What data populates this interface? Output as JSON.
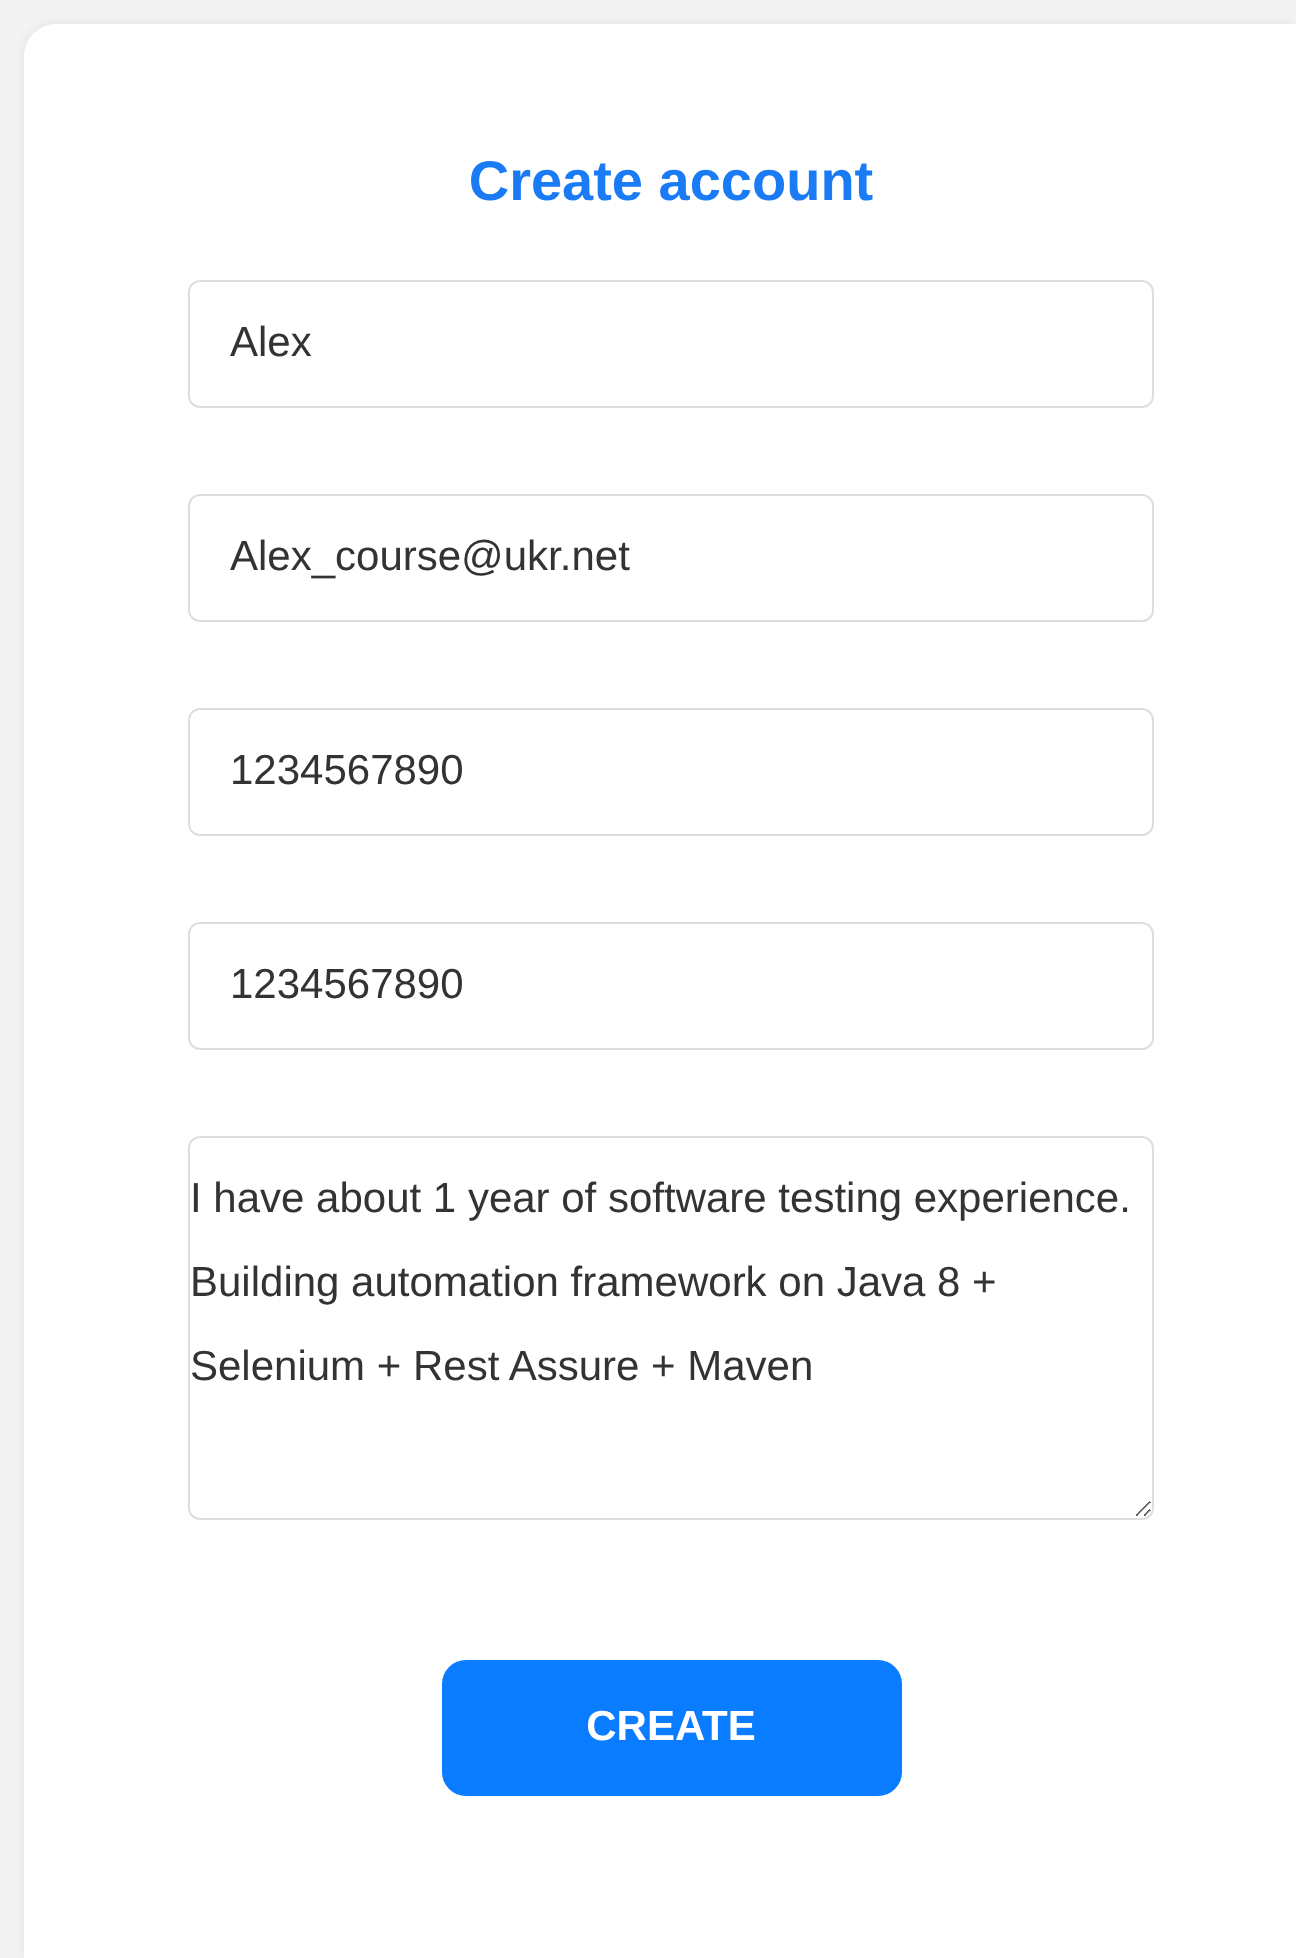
{
  "title": "Create account",
  "fields": [
    {
      "kind": "input",
      "value": "Alex"
    },
    {
      "kind": "input",
      "value": "Alex_course@ukr.net"
    },
    {
      "kind": "input",
      "value": "1234567890"
    },
    {
      "kind": "input",
      "value": "1234567890"
    },
    {
      "kind": "textarea",
      "value": "I have about 1 year of software testing experience. Building automation framework on Java 8 + Selenium + Rest Assure + Maven"
    }
  ],
  "button": "CREATE"
}
